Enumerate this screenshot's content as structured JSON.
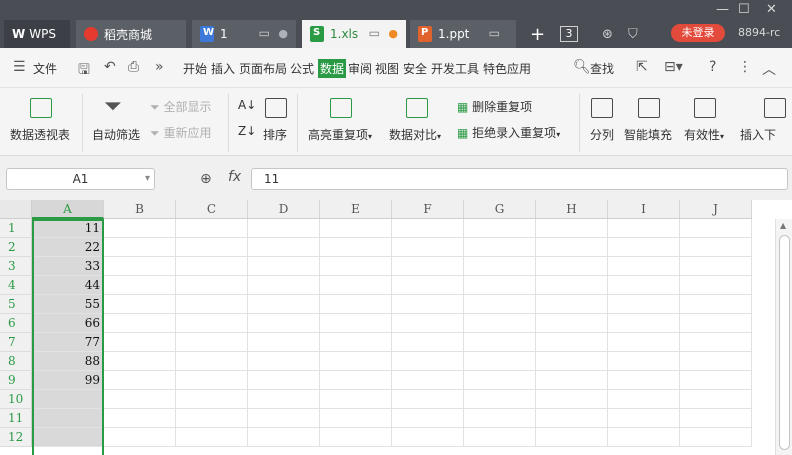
{
  "tabs": [
    {
      "label": "WPS"
    },
    {
      "label": "稻壳商城"
    },
    {
      "label": "1"
    },
    {
      "label": "1.xls"
    },
    {
      "label": "1.ppt"
    }
  ],
  "tab_count": "3",
  "account": {
    "login_label": "未登录",
    "user_id": "8894-rc"
  },
  "menu": {
    "file": "文件",
    "items": [
      "开始",
      "插入",
      "页面布局",
      "公式",
      "数据",
      "审阅",
      "视图",
      "安全",
      "开发工具",
      "特色应用"
    ],
    "active": "数据",
    "search": "查找"
  },
  "ribbon": {
    "pivot": "数据透视表",
    "autofilter": "自动筛选",
    "show_all": "全部显示",
    "reapply": "重新应用",
    "sort": "排序",
    "highlight_dup": "高亮重复项",
    "compare": "数据对比",
    "delete_dup": "删除重复项",
    "reject_dup": "拒绝录入重复项",
    "split": "分列",
    "smart_fill": "智能填充",
    "validity": "有效性",
    "insert_dropdown": "插入下"
  },
  "formula": {
    "cell_ref": "A1",
    "fx": "fx",
    "value": "11"
  },
  "sheet": {
    "columns": [
      "A",
      "B",
      "C",
      "D",
      "E",
      "F",
      "G",
      "H",
      "I",
      "J"
    ],
    "rows": [
      "1",
      "2",
      "3",
      "4",
      "5",
      "6",
      "7",
      "8",
      "9",
      "10",
      "11",
      "12"
    ],
    "colA_values": [
      "11",
      "22",
      "33",
      "44",
      "55",
      "66",
      "77",
      "88",
      "99",
      "",
      "",
      ""
    ],
    "accent_color": "#2b9a45"
  }
}
